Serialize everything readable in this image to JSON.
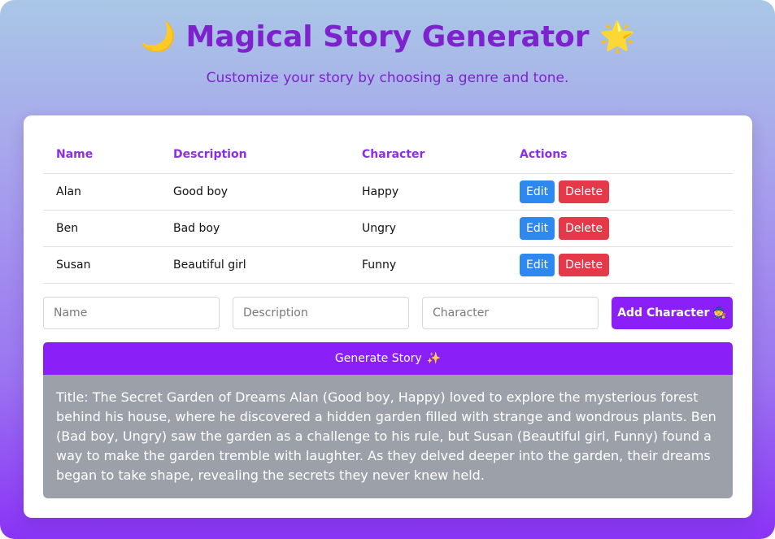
{
  "header": {
    "moon_emoji": "🌙",
    "title": "Magical Story Generator",
    "star_emoji": "🌟",
    "subtitle": "Customize your story by choosing a genre and tone."
  },
  "table": {
    "headers": [
      "Name",
      "Description",
      "Character",
      "Actions"
    ],
    "rows": [
      {
        "name": "Alan",
        "description": "Good boy",
        "character": "Happy"
      },
      {
        "name": "Ben",
        "description": "Bad boy",
        "character": "Ungry"
      },
      {
        "name": "Susan",
        "description": "Beautiful girl",
        "character": "Funny"
      }
    ],
    "edit_label": "Edit",
    "delete_label": "Delete"
  },
  "form": {
    "name_placeholder": "Name",
    "description_placeholder": "Description",
    "character_placeholder": "Character",
    "add_label": "Add Character",
    "add_emoji": "🧙"
  },
  "generate": {
    "label": "Generate Story",
    "emoji": "✨"
  },
  "story": {
    "text": "Title: The Secret Garden of Dreams Alan (Good boy, Happy) loved to explore the mysterious forest behind his house, where he discovered a hidden garden filled with strange and wondrous plants. Ben (Bad boy, Ungry) saw the garden as a challenge to his rule, but Susan (Beautiful girl, Funny) found a way to make the garden tremble with laughter. As they delved deeper into the garden, their dreams began to take shape, revealing the secrets they never knew held."
  },
  "colors": {
    "accent": "#8a1ff7",
    "title": "#7e22ce",
    "edit": "#2d88f0",
    "delete": "#e5394a",
    "story_bg": "#9ca1a9"
  }
}
